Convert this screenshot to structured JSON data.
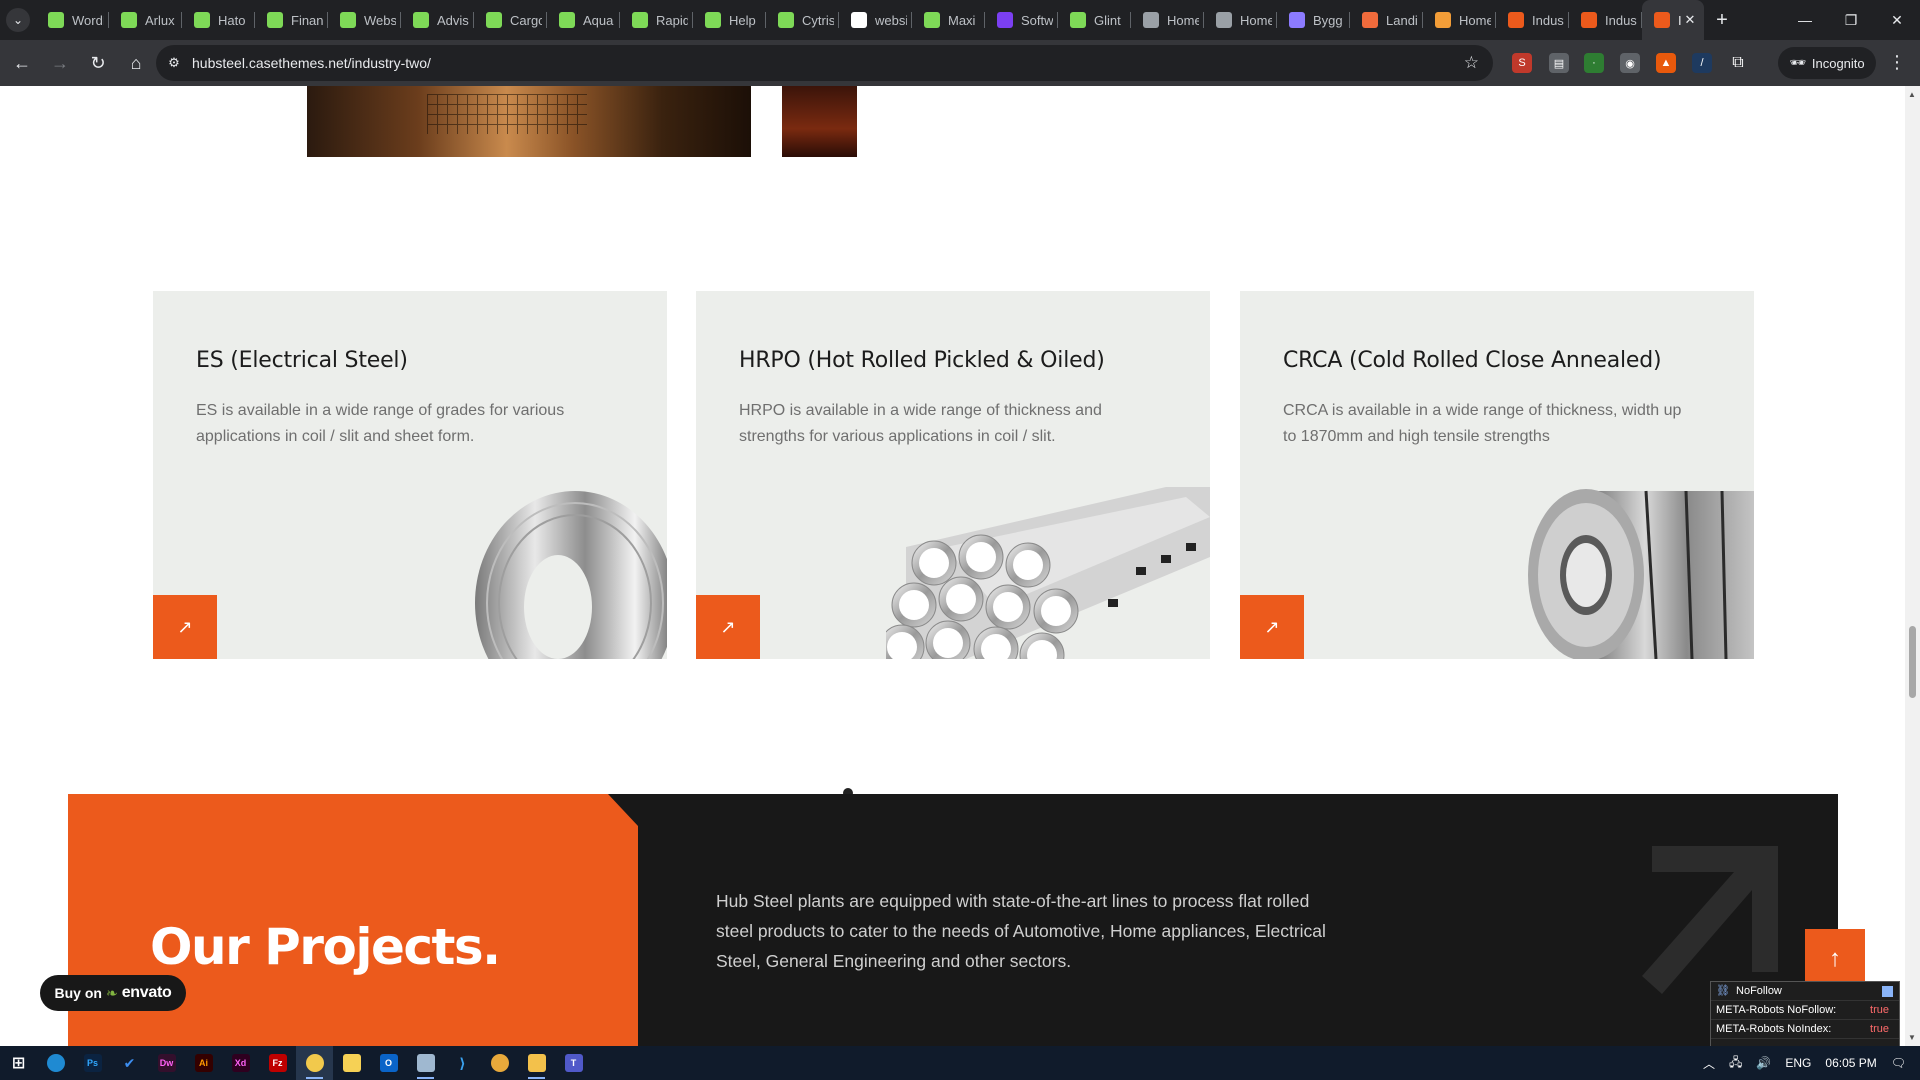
{
  "browser": {
    "tabs": [
      {
        "label": "WordPress",
        "icon": "elementor-icon",
        "color": "#7ed957"
      },
      {
        "label": "Arlux",
        "icon": "elementor-icon",
        "color": "#7ed957"
      },
      {
        "label": "Hato",
        "icon": "elementor-icon",
        "color": "#7ed957"
      },
      {
        "label": "Finance",
        "icon": "elementor-icon",
        "color": "#7ed957"
      },
      {
        "label": "Website",
        "icon": "elementor-icon",
        "color": "#7ed957"
      },
      {
        "label": "Advisor",
        "icon": "elementor-icon",
        "color": "#7ed957"
      },
      {
        "label": "Cargo",
        "icon": "elementor-icon",
        "color": "#7ed957"
      },
      {
        "label": "Aqua",
        "icon": "elementor-icon",
        "color": "#7ed957"
      },
      {
        "label": "Rapid",
        "icon": "elementor-icon",
        "color": "#7ed957"
      },
      {
        "label": "Help",
        "icon": "elementor-icon",
        "color": "#7ed957"
      },
      {
        "label": "Cytris",
        "icon": "elementor-icon",
        "color": "#7ed957"
      },
      {
        "label": "website",
        "icon": "google-icon",
        "color": "#ffffff"
      },
      {
        "label": "Maxi",
        "icon": "elementor-icon",
        "color": "#7ed957"
      },
      {
        "label": "Software",
        "icon": "s-brand-icon",
        "color": "#7b3ff2"
      },
      {
        "label": "Glint",
        "icon": "elementor-icon",
        "color": "#7ed957"
      },
      {
        "label": "Home",
        "icon": "diamond-icon",
        "color": "#9aa0a6"
      },
      {
        "label": "Home",
        "icon": "diamond-icon",
        "color": "#9aa0a6"
      },
      {
        "label": "Bygg",
        "icon": "c-brand-icon",
        "color": "#8c7bff"
      },
      {
        "label": "Landing",
        "icon": "house-brand-icon",
        "color": "#f06b3c"
      },
      {
        "label": "Home",
        "icon": "v-brand-icon",
        "color": "#f29d38"
      },
      {
        "label": "Industry",
        "icon": "elephant-icon",
        "color": "#ec5a1c"
      },
      {
        "label": "Industry",
        "icon": "elephant-icon",
        "color": "#ec5a1c"
      }
    ],
    "active_tab": {
      "label": "I",
      "icon": "elephant-icon",
      "color": "#ec5a1c"
    },
    "url": "hubsteel.casethemes.net/industry-two/",
    "incognito_label": "Incognito"
  },
  "cards": [
    {
      "title": "ES (Electrical Steel)",
      "desc": "ES is available in a wide range of grades for various applications in coil / slit and sheet form.",
      "image": "steel-wire-coil"
    },
    {
      "title": "HRPO (Hot Rolled Pickled & Oiled)",
      "desc": "HRPO is available in a wide range of thickness and strengths for various applications in coil / slit.",
      "image": "steel-pipe-bundle"
    },
    {
      "title": "CRCA (Cold Rolled Close Annealed)",
      "desc": "CRCA is available in a wide range of thickness, width up to 1870mm and high tensile strengths",
      "image": "steel-sheet-coil"
    }
  ],
  "projects": {
    "title": "Our Projects.",
    "desc": "Hub Steel plants are equipped with state-of-the-art lines to process flat rolled steel products to cater to the needs of Automotive, Home appliances, Electrical Steel, General Engineering and other sectors."
  },
  "buy_button": {
    "prefix": "Buy on",
    "brand": "envato"
  },
  "seo_panel": {
    "title": "NoFollow",
    "rows": [
      {
        "label": "META-Robots NoFollow:",
        "value": "true"
      },
      {
        "label": "META-Robots NoIndex:",
        "value": "true"
      }
    ]
  },
  "taskbar": {
    "language": "ENG",
    "time": "06:05 PM"
  },
  "colors": {
    "accent": "#ec5a1c",
    "card_bg": "#eceeeb",
    "dark_section": "#181818"
  }
}
